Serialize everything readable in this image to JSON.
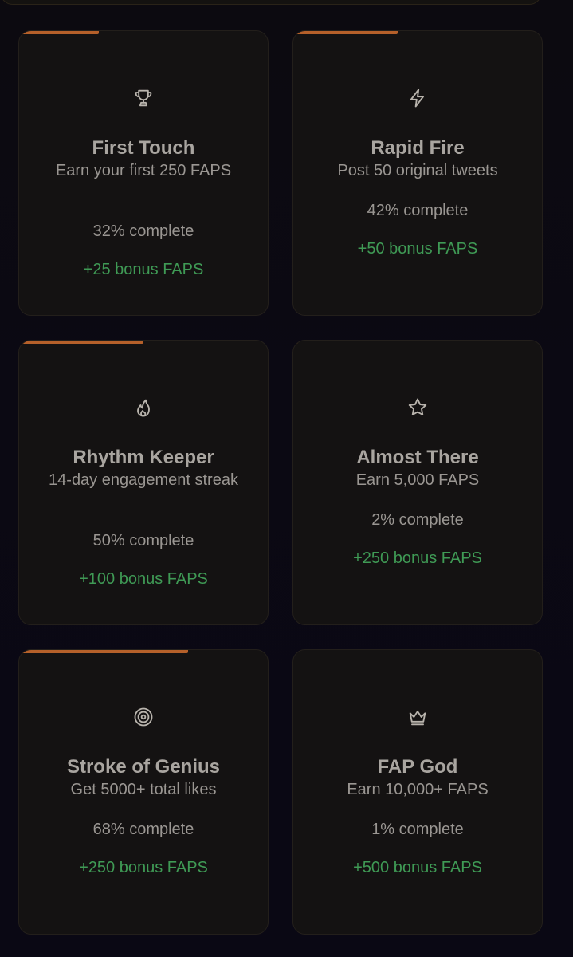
{
  "colors": {
    "background": "#0b0913",
    "card_background": "#141212",
    "card_border": "#231f1b",
    "accent_progress": "#b5602a",
    "title_text": "#a9a5a0",
    "body_text": "#9a9692",
    "bonus_text": "#3f9a55"
  },
  "achievements": [
    {
      "icon": "trophy-icon",
      "title": "First Touch",
      "description": "Earn your first 250 FAPS",
      "progress_label": "32% complete",
      "progress": 0.32,
      "bonus": "+25 bonus FAPS"
    },
    {
      "icon": "lightning-icon",
      "title": "Rapid Fire",
      "description": "Post 50 original tweets",
      "progress_label": "42% complete",
      "progress": 0.42,
      "bonus": "+50 bonus FAPS"
    },
    {
      "icon": "flame-icon",
      "title": "Rhythm Keeper",
      "description": "14-day engagement streak",
      "progress_label": "50% complete",
      "progress": 0.5,
      "bonus": "+100 bonus FAPS"
    },
    {
      "icon": "star-icon",
      "title": "Almost There",
      "description": "Earn 5,000 FAPS",
      "progress_label": "2% complete",
      "progress": 0.02,
      "bonus": "+250 bonus FAPS"
    },
    {
      "icon": "target-icon",
      "title": "Stroke of Genius",
      "description": "Get 5000+ total likes",
      "progress_label": "68% complete",
      "progress": 0.68,
      "bonus": "+250 bonus FAPS"
    },
    {
      "icon": "crown-icon",
      "title": "FAP God",
      "description": "Earn 10,000+ FAPS",
      "progress_label": "1% complete",
      "progress": 0.01,
      "bonus": "+500 bonus FAPS"
    }
  ]
}
